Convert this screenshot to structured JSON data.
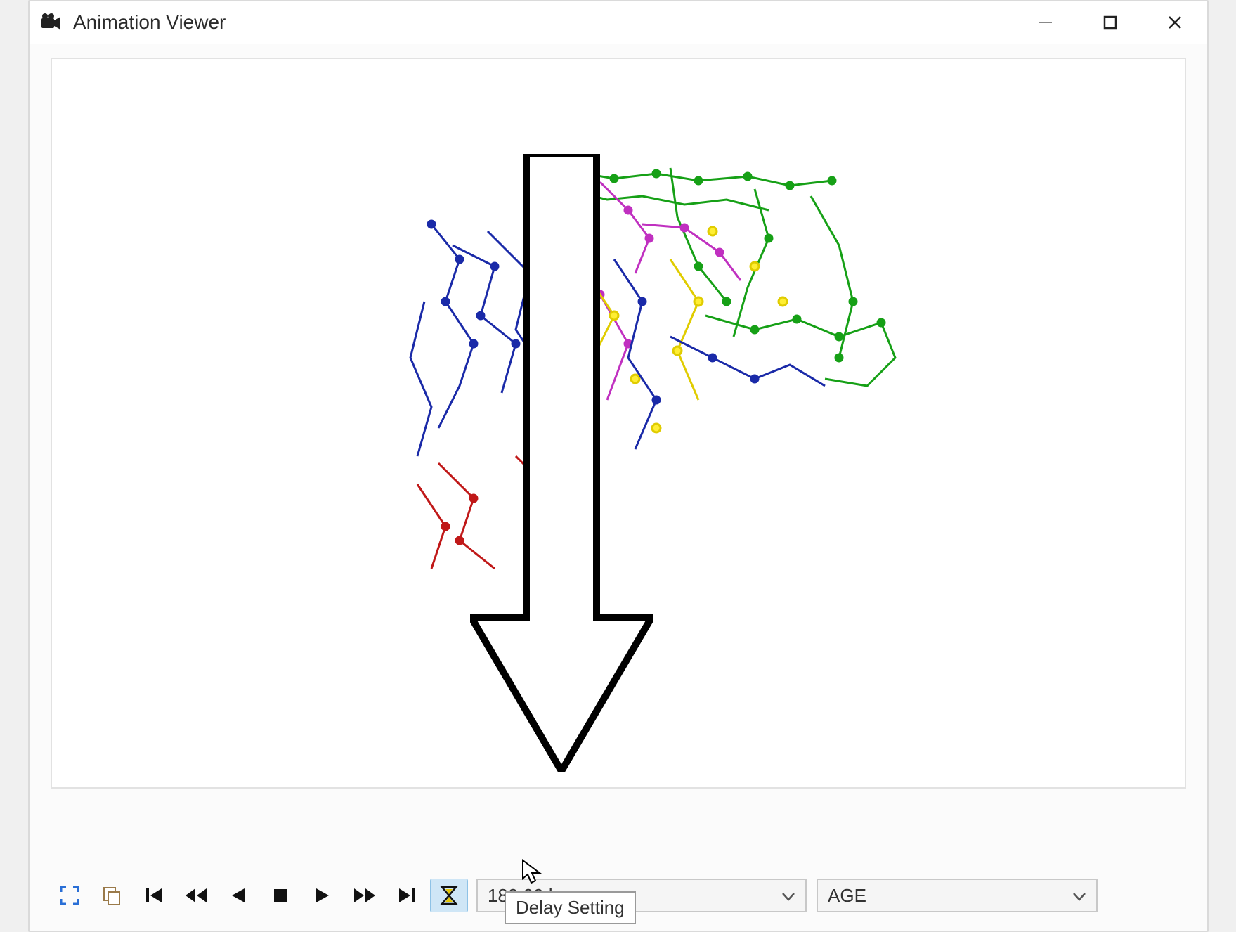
{
  "window": {
    "title": "Animation Viewer",
    "icon": "camera-icon"
  },
  "controls": {
    "minimize": "minimize",
    "maximize": "maximize",
    "close": "close"
  },
  "toolbar": {
    "fullscreen_icon": "fullscreen-icon",
    "copy_icon": "copy-icon",
    "first_icon": "skip-first-icon",
    "fastback_icon": "fast-backward-icon",
    "back_icon": "step-backward-icon",
    "stop_icon": "stop-icon",
    "play_icon": "play-icon",
    "fastfwd_icon": "fast-forward-icon",
    "last_icon": "skip-last-icon",
    "delay_icon": "hourglass-icon"
  },
  "time_selector": {
    "value": "180:00 hrs"
  },
  "parameter_selector": {
    "value": "AGE"
  },
  "tooltip": {
    "text": "Delay Setting"
  },
  "annotation": {
    "description": "large down arrow pointing to delay button"
  }
}
